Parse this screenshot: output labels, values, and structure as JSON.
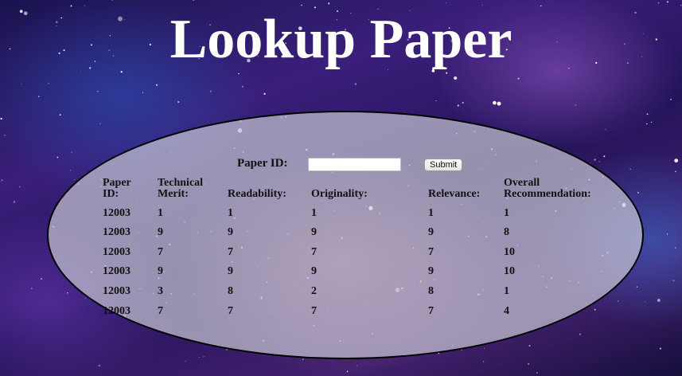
{
  "title": "Lookup Paper",
  "form": {
    "label": "Paper ID:",
    "input_value": "",
    "submit_label": "Submit"
  },
  "table": {
    "headers": [
      [
        "Paper",
        "ID:"
      ],
      [
        "Technical",
        "Merit:"
      ],
      [
        "Readability:"
      ],
      [
        "Originality:"
      ],
      [
        "Relevance:"
      ],
      [
        "Overall",
        "Recommendation:"
      ]
    ],
    "rows": [
      [
        "12003",
        "1",
        "1",
        "1",
        "1",
        "1"
      ],
      [
        "12003",
        "9",
        "9",
        "9",
        "9",
        "8"
      ],
      [
        "12003",
        "7",
        "7",
        "7",
        "7",
        "10"
      ],
      [
        "12003",
        "9",
        "9",
        "9",
        "9",
        "10"
      ],
      [
        "12003",
        "3",
        "8",
        "2",
        "8",
        "1"
      ],
      [
        "12003",
        "7",
        "7",
        "7",
        "7",
        "4"
      ]
    ]
  }
}
